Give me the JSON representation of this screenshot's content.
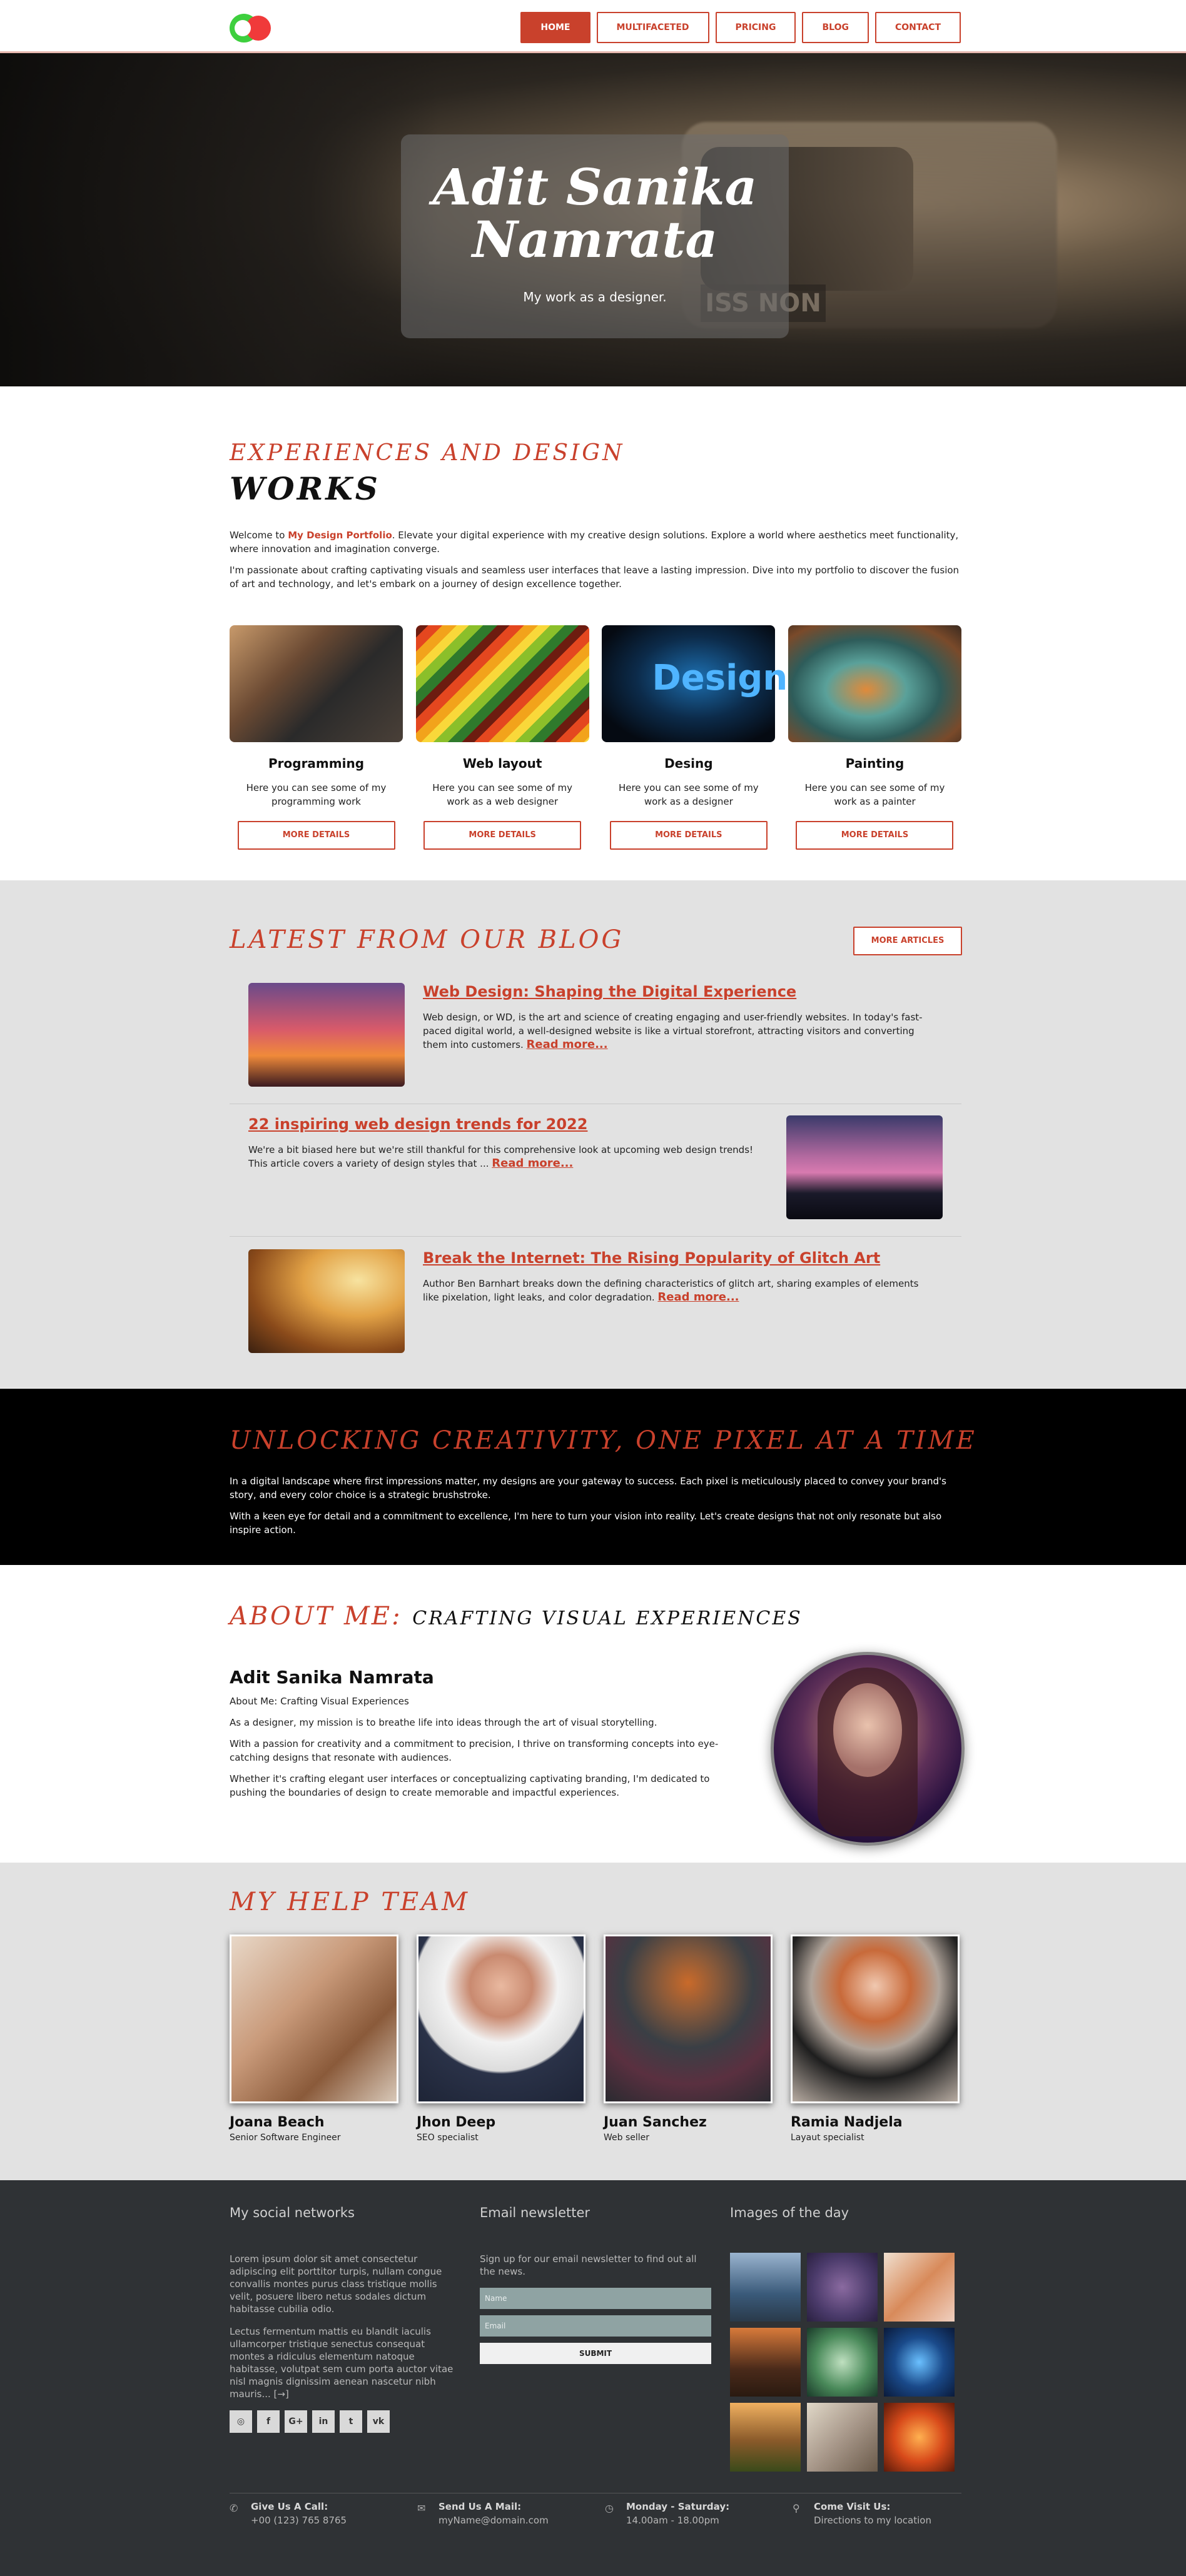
{
  "header": {
    "logo": "logo",
    "nav": [
      {
        "label": "HOME",
        "active": true
      },
      {
        "label": "MULTIFACETED"
      },
      {
        "label": "PRICING"
      },
      {
        "label": "BLOG"
      },
      {
        "label": "CONTACT"
      }
    ]
  },
  "hero": {
    "title": "Adit Sanika Namrata",
    "subtitle": "My work as a designer."
  },
  "works": {
    "kicker": "EXPERIENCES AND DESIGN",
    "title": "WORKS",
    "intro_1_before": "Welcome to ",
    "intro_1_highlight": "My Design Portfolio",
    "intro_1_after": ". Elevate your digital experience with my creative design solutions. Explore a world where aesthetics meet functionality, where innovation and imagination converge.",
    "intro_2": "I'm passionate about crafting captivating visuals and seamless user interfaces that leave a lasting impression. Dive into my portfolio to discover the fusion of art and technology, and let's embark on a journey of design excellence together.",
    "cards": [
      {
        "title": "Programming",
        "text": "Here you can see some of my programming work",
        "button": "MORE DETAILS"
      },
      {
        "title": "Web layout",
        "text": "Here you can see some of my work as a web designer",
        "button": "MORE DETAILS"
      },
      {
        "title": "Desing",
        "text": "Here you can see some of my work as a designer",
        "button": "MORE DETAILS"
      },
      {
        "title": "Painting",
        "text": "Here you can see some of my work as a painter",
        "button": "MORE DETAILS"
      }
    ]
  },
  "blog": {
    "title": "LATEST FROM OUR BLOG",
    "more": "MORE ARTICLES",
    "posts": [
      {
        "title": "Web Design: Shaping the Digital Experience",
        "text": "Web design, or WD, is the art and science of creating engaging and user-friendly websites. In today's fast-paced digital world, a well-designed website is like a virtual storefront, attracting visitors and converting them into customers.",
        "link": "Read more..."
      },
      {
        "title": "22 inspiring web design trends for 2022",
        "text": "We're a bit biased here but we're still thankful for this comprehensive look at upcoming web design trends! This article covers a variety of design styles that ...",
        "link": "Read more..."
      },
      {
        "title": "Break the Internet: The Rising Popularity of Glitch Art",
        "text": "Author Ben Barnhart breaks down the defining characteristics of glitch art, sharing examples of elements like pixelation, light leaks, and color degradation.",
        "link": "Read more..."
      }
    ]
  },
  "band": {
    "title": "UNLOCKING CREATIVITY, ONE PIXEL AT A TIME",
    "p1": "In a digital landscape where first impressions matter, my designs are your gateway to success. Each pixel is meticulously placed to convey your brand's story, and every color choice is a strategic brushstroke.",
    "p2": "With a keen eye for detail and a commitment to excellence, I'm here to turn your vision into reality. Let's create designs that not only resonate but also inspire action."
  },
  "about": {
    "title": "ABOUT ME:",
    "subtitle": "CRAFTING VISUAL EXPERIENCES",
    "name": "Adit Sanika Namrata",
    "p0": "About Me: Crafting Visual Experiences",
    "p1": "As a designer, my mission is to breathe life into ideas through the art of visual storytelling.",
    "p2": "With a passion for creativity and a commitment to precision, I thrive on transforming concepts into eye-catching designs that resonate with audiences.",
    "p3": "Whether it's crafting elegant user interfaces or conceptualizing captivating branding, I'm dedicated to pushing the boundaries of design to create memorable and impactful experiences."
  },
  "team": {
    "title": "MY HELP TEAM",
    "members": [
      {
        "name": "Joana Beach",
        "role": "Senior Software Engineer"
      },
      {
        "name": "Jhon Deep",
        "role": "SEO specialist"
      },
      {
        "name": "Juan Sanchez",
        "role": "Web seller"
      },
      {
        "name": "Ramia Nadjela",
        "role": "Layaut specialist"
      }
    ]
  },
  "footer": {
    "social_title": "My social networks",
    "social_p1": "Lorem ipsum dolor sit amet consectetur adipiscing elit porttitor turpis, nullam congue convallis montes purus class tristique mollis velit, posuere libero netus sodales dictum habitasse cubilia odio.",
    "social_p2": "Lectus fermentum mattis eu blandit iaculis ullamcorper tristique senectus consequat montes a ridiculus elementum natoque habitasse, volutpat sem cum porta auctor vitae nisl magnis dignissim aenean nascetur nibh mauris...",
    "social_icons": [
      "dribbble-icon",
      "facebook-icon",
      "google-plus-icon",
      "linkedin-icon",
      "twitter-icon",
      "vk-icon"
    ],
    "news_title": "Email newsletter",
    "news_text": "Sign up for our email newsletter to find out all the news.",
    "name_placeholder": "Name",
    "email_placeholder": "Email",
    "submit": "SUBMIT",
    "images_title": "Images of the day",
    "info": [
      {
        "label": "Give Us A Call:",
        "value": "+00 (123) 765 8765",
        "icon": "phone-icon"
      },
      {
        "label": "Send Us A Mail:",
        "value": "myName@domain.com",
        "icon": "mail-icon"
      },
      {
        "label": "Monday - Saturday:",
        "value": "14.00am - 18.00pm",
        "icon": "clock-icon"
      },
      {
        "label": "Come Visit Us:",
        "value": "Directions to my location",
        "icon": "location-icon"
      }
    ]
  },
  "colors": {
    "accent": "#c9412c",
    "footer_bg": "#2f3235",
    "section_grey": "#e2e2e2"
  }
}
